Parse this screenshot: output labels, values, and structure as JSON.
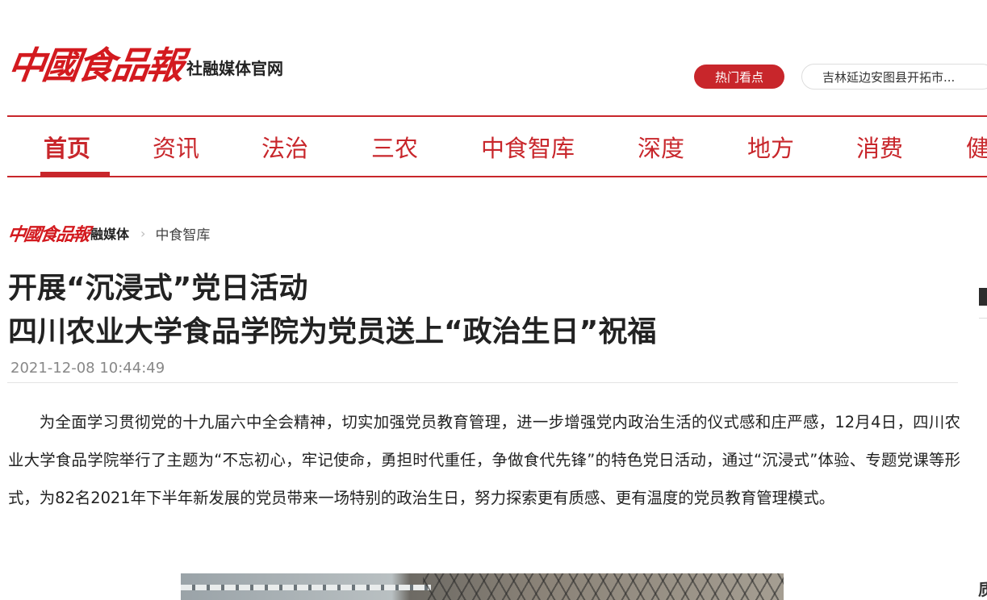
{
  "header": {
    "logo_text": "中國食品報",
    "logo_sub": "社融媒体官网",
    "hot_label": "热门看点",
    "hot_ticker": "吉林延边安图县开拓市..."
  },
  "nav": {
    "items": [
      "首页",
      "资讯",
      "法治",
      "三农",
      "中食智库",
      "深度",
      "地方",
      "消费",
      "健"
    ]
  },
  "breadcrumb": {
    "logo_text": "中國食品報",
    "logo_sub": "融媒体",
    "section": "中食智库"
  },
  "article": {
    "title_line1": "开展“沉浸式”党日活动",
    "title_line2": "四川农业大学食品学院为党员送上“政治生日”祝福",
    "datetime": "2021-12-08 10:44:49",
    "paragraph": "为全面学习贯彻党的十九届六中全会精神，切实加强党员教育管理，进一步增强党内政治生活的仪式感和庄严感，12月4日，四川农业大学食品学院举行了主题为“不忘初心，牢记使命，勇担时代重任，争做食代先锋”的特色党日活动，通过“沉浸式”体验、专题党课等形式，为82名2021年下半年新发展的党员带来一场特别的政治生日，努力探索更有质感、更有温度的党员教育管理模式。"
  },
  "sidebar": {
    "partial_char": "质"
  },
  "colors": {
    "brand_red": "#c8262b",
    "text": "#222222",
    "muted": "#888888"
  }
}
